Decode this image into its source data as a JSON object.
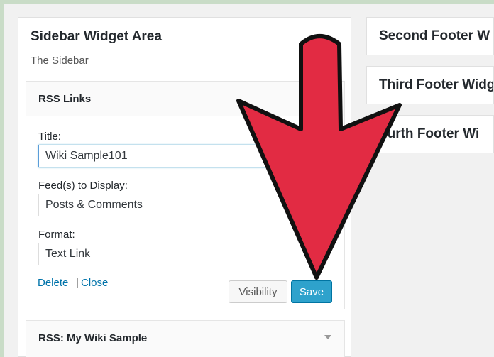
{
  "sidebar_area": {
    "title": "Sidebar Widget Area",
    "subtitle": "The Sidebar"
  },
  "rss_widget": {
    "header": "RSS Links",
    "title_label": "Title:",
    "title_value": "Wiki Sample101",
    "feeds_label": "Feed(s) to Display:",
    "feeds_value": "Posts & Comments",
    "format_label": "Format:",
    "format_value": "Text Link",
    "delete_label": "Delete",
    "separator": "|",
    "close_label": "Close",
    "visibility_label": "Visibility",
    "save_label": "Save"
  },
  "rss_widget_2": {
    "header": "RSS: My Wiki Sample"
  },
  "footer_areas": [
    {
      "title": "Second Footer W"
    },
    {
      "title": "Third Footer Widg"
    },
    {
      "title": "ourth Footer Wi"
    }
  ],
  "colors": {
    "arrow": "#e22b43",
    "save_button": "#2ea2cc",
    "link": "#0073aa"
  }
}
